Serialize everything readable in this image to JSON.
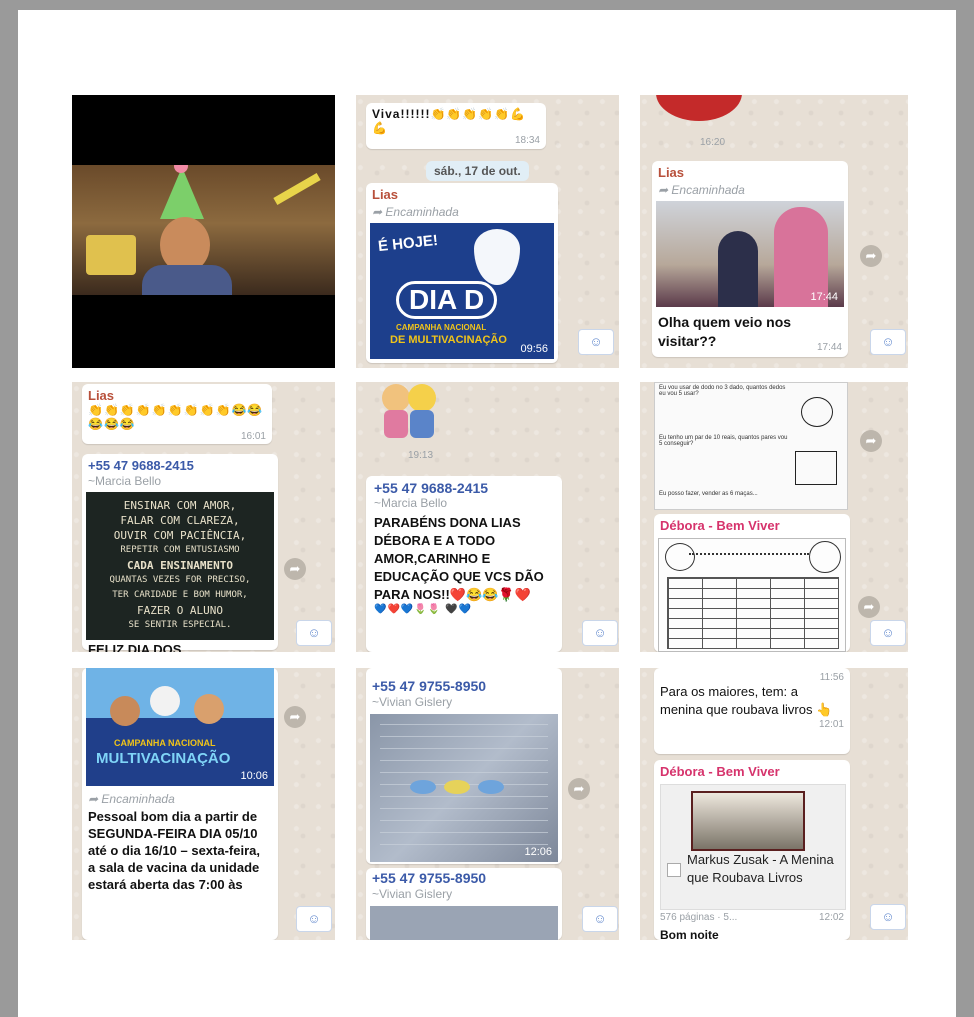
{
  "c1": {
    "scene": "child-birthday-party-photo"
  },
  "c2": {
    "top_text": "Viva!!!!!!👏👏👏👏👏💪💪",
    "top_time": "18:34",
    "date_pill": "sáb., 17 de out.",
    "sender": "Lias",
    "forwarded": "Encaminhada",
    "poster_hoje": "É HOJE!",
    "poster_diad": "DIA D",
    "poster_line1": "CAMPANHA NACIONAL",
    "poster_line2": "DE MULTIVACINAÇÃO",
    "time": "09:56"
  },
  "c3": {
    "top_time": "16:20",
    "sender": "Lias",
    "forwarded": "Encaminhada",
    "photo_time": "17:44",
    "message": "Olha quem veio nos visitar??",
    "time": "17:44"
  },
  "c4": {
    "sender": "Lias",
    "emojis": "👏👏👏👏👏👏👏👏👏😂😂😂😂😂",
    "time": "16:01",
    "phone": "+55 47 9688-2415",
    "subname": "~Marcia Bello",
    "chalk": [
      "ENSINAR COM AMOR,",
      "FALAR COM CLAREZA,",
      "OUVIR COM PACIÊNCIA,",
      "REPETIR COM ENTUSIASMO",
      "CADA ENSINAMENTO",
      "QUANTAS VEZES FOR PRECISO,",
      "TER CARIDADE E BOM HUMOR,",
      "FAZER O ALUNO",
      "SE SENTIR ESPECIAL."
    ],
    "caption": "FELIZ DIA DOS"
  },
  "c5": {
    "sticker_time": "19:13",
    "phone": "+55 47 9688-2415",
    "subname": "~Marcia Bello",
    "message": "PARABÉNS DONA LIAS DÉBORA E A TODO AMOR,CARINHO E EDUCAÇÃO QUE VCS DÃO PARA NOS!!❤️😂😂🌹❤️",
    "emoji_row": "💙❤️💙🌷🌷 🖤💙"
  },
  "c6": {
    "ws_q1": "Eu vou usar de dodo no 3 dado, quantos dedos eu vou 5 usar?",
    "ws_q2": "Eu tenho um par de 10 reais, quantos pares vou 5 conseguir?",
    "ws_q3": "Eu posso fazer, vender as 6 maças...",
    "sender": "Débora - Bem Viver"
  },
  "c7": {
    "poster_line1": "CAMPANHA NACIONAL",
    "poster_line2": "MULTIVACINAÇÃO",
    "time": "10:06",
    "forwarded": "Encaminhada",
    "message": "Pessoal bom dia a partir de SEGUNDA-FEIRA DIA 05/10 até o dia 16/10 – sexta-feira, a sala de vacina da unidade estará aberta das 7:00 às"
  },
  "c8": {
    "phone": "+55 47 9755-8950",
    "subname": "~Vivian Gislery",
    "photo_time": "12:06",
    "phone2": "+55 47 9755-8950",
    "subname2": "~Vivian Gislery"
  },
  "c9": {
    "top_time": "11:56",
    "message": "Para os maiores, tem: a menina que roubava livros 👆",
    "time": "12:01",
    "sender": "Débora - Bem Viver",
    "link_title": "Markus Zusak - A Menina que Roubava Livros",
    "footer": "576 páginas · 5...",
    "footer_time": "12:02",
    "cut_text": "Bom noite"
  },
  "icons": {
    "share": "share-arrow-icon",
    "react": "reaction-icon",
    "forward": "forward-arrow-icon"
  },
  "colors": {
    "chat_bg": "#e7dfd5",
    "sender_lias": "#b8503b",
    "sender_debora": "#d6336c",
    "phone": "#3b5aa8"
  }
}
